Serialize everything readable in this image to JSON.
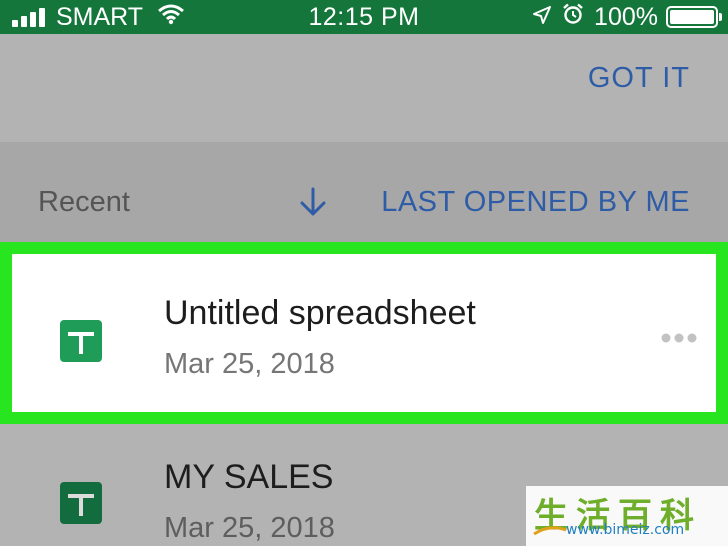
{
  "status_bar": {
    "carrier": "SMART",
    "time": "12:15 PM",
    "battery": "100%"
  },
  "banner": {
    "got_it_label": "GOT IT"
  },
  "sort_bar": {
    "section_label": "Recent",
    "sort_label": "LAST OPENED BY ME"
  },
  "files": [
    {
      "title": "Untitled spreadsheet",
      "date": "Mar 25, 2018"
    },
    {
      "title": "MY SALES",
      "date": "Mar 25, 2018"
    }
  ],
  "watermark": {
    "chars": "生活百科",
    "url": "www.bimeiz.com"
  },
  "colors": {
    "status_bar": "#14763a",
    "accent_link": "#2f5ca6",
    "highlight_border": "#27e61f",
    "sheets_green": "#1e9c58"
  }
}
